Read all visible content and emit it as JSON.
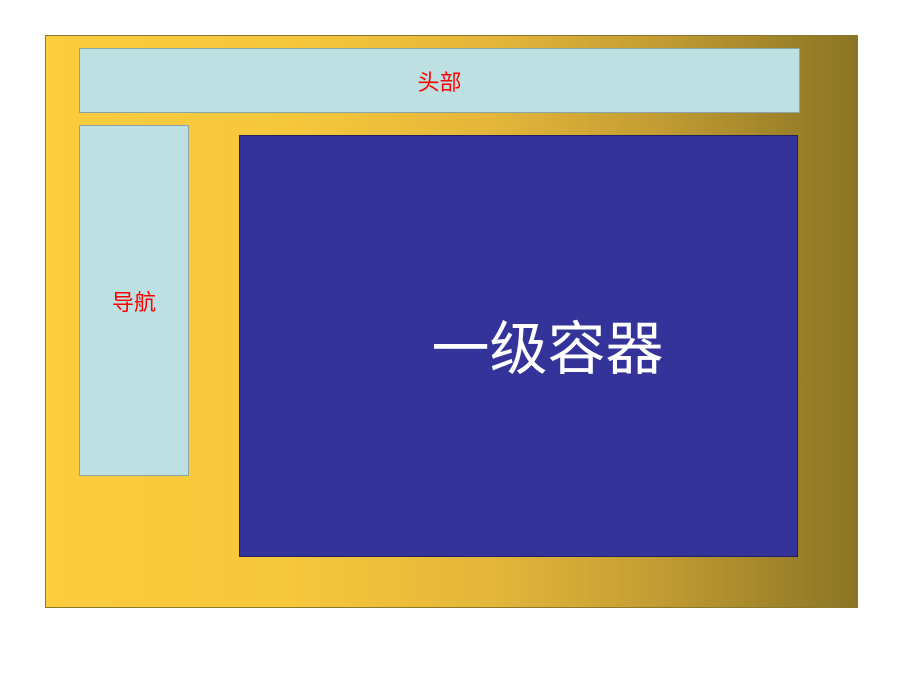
{
  "header": {
    "label": "头部",
    "label_color": "#ff0000",
    "background": "#bde1e3"
  },
  "nav": {
    "label": "导航",
    "label_color": "#ff0000",
    "background": "#bde1e3"
  },
  "container": {
    "label": "一级容器",
    "label_color": "#ffffff",
    "background": "#333399"
  },
  "frame": {
    "gradient_start": "#fdcd3e",
    "gradient_end": "#8a7424"
  }
}
